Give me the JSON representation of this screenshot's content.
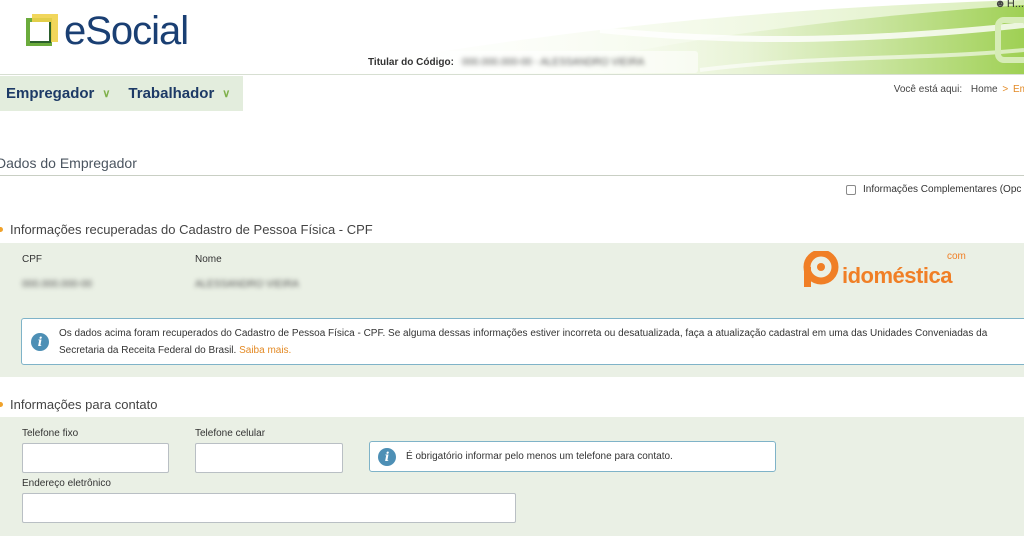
{
  "header": {
    "app_name": "eSocial",
    "titular_label": "Titular do Código:",
    "titular_value": "000.000.000-00 - ALESSANDRO VIEIRA",
    "user_name": "H..."
  },
  "nav": {
    "items": [
      {
        "label": "Empregador"
      },
      {
        "label": "Trabalhador"
      }
    ]
  },
  "breadcrumb": {
    "prefix": "Você está aqui:",
    "home": "Home",
    "separator": ">",
    "current": "Em"
  },
  "page": {
    "title": "Dados do Empregador",
    "complementary_label": "Informações Complementares (Opc"
  },
  "cpf_section": {
    "heading": "Informações recuperadas do Cadastro de Pessoa Física - CPF",
    "cpf_label": "CPF",
    "cpf_value": "000.000.000-00",
    "nome_label": "Nome",
    "nome_value": "ALESSANDRO VIEIRA",
    "info_text": "Os dados acima foram recuperados do Cadastro de Pessoa Física - CPF. Se alguma dessas informações estiver incorreta ou desatualizada, faça a atualização cadastral em uma das Unidades Conveniadas da Secretaria da Receita Federal do Brasil.",
    "info_link": "Saiba mais."
  },
  "contact_section": {
    "heading": "Informações para contato",
    "telefone_fixo_label": "Telefone fixo",
    "telefone_celular_label": "Telefone celular",
    "info_text": "É obrigatório informar pelo menos um telefone para contato.",
    "email_label": "Endereço eletrônico"
  },
  "watermark": {
    "text": "idoméstica",
    "suffix": "com"
  },
  "colors": {
    "brand_blue": "#1a3f73",
    "accent_orange": "#e38a25",
    "panel_green": "#eaf0e5",
    "info_blue": "#4d8fb5"
  }
}
